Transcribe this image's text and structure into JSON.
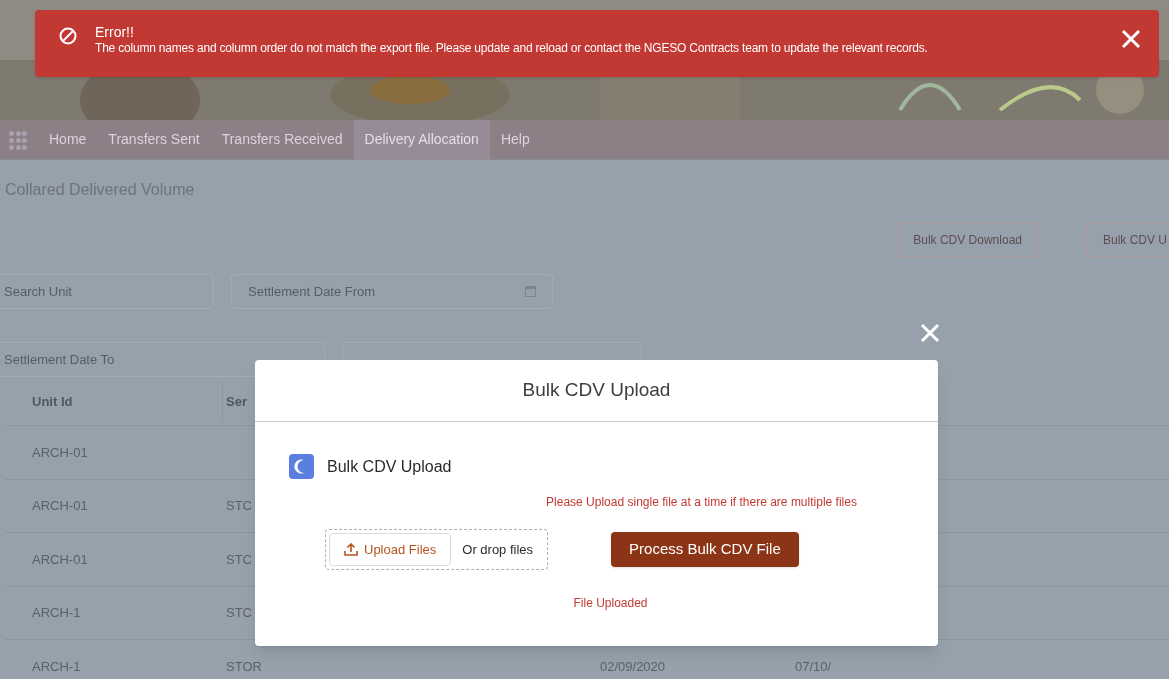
{
  "toast": {
    "title": "Error!!",
    "message": "The column names and column order do not match the export file. Please update and reload or contact the NGESO Contracts team to update the relevant records."
  },
  "nav": {
    "items": [
      {
        "label": "Home",
        "selected": false
      },
      {
        "label": "Transfers Sent",
        "selected": false
      },
      {
        "label": "Transfers Received",
        "selected": false
      },
      {
        "label": "Delivery Allocation",
        "selected": true
      },
      {
        "label": "Help",
        "selected": false
      }
    ]
  },
  "page": {
    "title": "Collared Delivered Volume",
    "buttons": [
      "Bulk CDV Download",
      "Bulk CDV U"
    ],
    "search_unit": {
      "placeholder": "Search Unit"
    },
    "date_from": {
      "placeholder": "Settlement Date From"
    },
    "date_to": {
      "placeholder": "Settlement Date To"
    }
  },
  "table": {
    "columns": [
      "Unit Id",
      "Ser"
    ],
    "rows": [
      {
        "cells": [
          "ARCH-01"
        ]
      },
      {
        "cells": [
          "ARCH-01",
          "STC"
        ]
      },
      {
        "cells": [
          "ARCH-01",
          "STC"
        ]
      },
      {
        "cells": [
          "ARCH-1",
          "STC"
        ]
      },
      {
        "cells": [
          "ARCH-1",
          "STOR",
          "02/09/2020",
          "07/10/"
        ]
      }
    ]
  },
  "modal": {
    "title": "Bulk CDV Upload",
    "card_title": "Bulk CDV Upload",
    "hint": "Please Upload single file at a time if there are multiple files",
    "upload_button": "Upload Files",
    "drop_label": "Or drop files",
    "process_button": "Process Bulk CDV File",
    "status": "File Uploaded"
  }
}
